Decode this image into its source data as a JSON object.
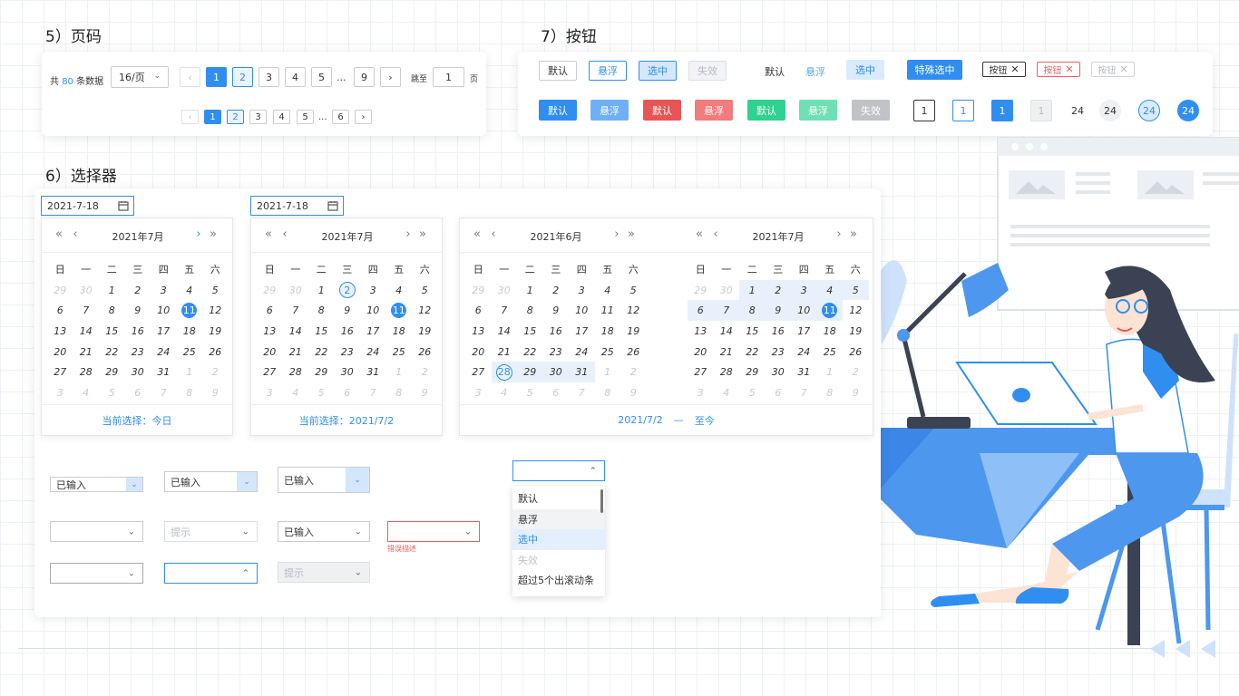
{
  "headings": {
    "pagination": "5）页码",
    "buttons": "7）按钮",
    "selector": "6）选择器"
  },
  "pagination": {
    "total_prefix": "共",
    "total_count": "80",
    "total_suffix": "条数据",
    "page_size": "16/页",
    "row1_pages": [
      "1",
      "2",
      "3",
      "4",
      "5",
      "...",
      "9"
    ],
    "row2_pages": [
      "1",
      "2",
      "3",
      "4",
      "5",
      "...",
      "6"
    ],
    "jump_label": "跳至",
    "jump_value": "1",
    "jump_suffix": "页",
    "prev": "‹",
    "next": "›"
  },
  "buttons": {
    "row1": {
      "default": "默认",
      "hover": "悬浮",
      "selected": "选中",
      "disabled": "失效",
      "text_default": "默认",
      "text_hover": "悬浮",
      "light_selected": "选中",
      "special_selected": "特殊选中",
      "tag_default": "按钮",
      "tag_danger": "按钮",
      "tag_disabled": "按钮"
    },
    "row2": {
      "blue_default": "默认",
      "blue_hover": "悬浮",
      "red_default": "默认",
      "red_hover": "悬浮",
      "green_default": "默认",
      "green_hover": "悬浮",
      "gray_disabled": "失效",
      "num_default": "1",
      "num_hover": "1",
      "num_active": "1",
      "num_disabled": "1",
      "circle_plain": "24",
      "circle_gray": "24",
      "circle_hover": "24",
      "circle_active": "24"
    }
  },
  "datepicker": {
    "input1_value": "2021-7-18",
    "input2_value": "2021-7-18",
    "weekdays": [
      "日",
      "一",
      "二",
      "三",
      "四",
      "五",
      "六"
    ],
    "cal1_title": "2021年7月",
    "cal2_title": "2021年7月",
    "cal3_title": "2021年6月",
    "cal4_title": "2021年7月",
    "cal1_footer": "当前选择：今日",
    "cal2_footer": "当前选择：2021/7/2",
    "range_footer_start": "2021/7/2",
    "range_footer_sep": "—",
    "range_footer_end": "至今",
    "july_days": [
      [
        "29",
        "30",
        "1",
        "2",
        "3",
        "4",
        "5"
      ],
      [
        "6",
        "7",
        "8",
        "9",
        "10",
        "11",
        "12"
      ],
      [
        "13",
        "14",
        "15",
        "16",
        "17",
        "18",
        "19"
      ],
      [
        "20",
        "21",
        "22",
        "23",
        "24",
        "25",
        "26"
      ],
      [
        "27",
        "28",
        "29",
        "30",
        "31",
        "1",
        "2"
      ],
      [
        "3",
        "4",
        "5",
        "6",
        "7",
        "8",
        "9"
      ]
    ],
    "june_days": [
      [
        "29",
        "30",
        "1",
        "2",
        "3",
        "4",
        "5"
      ],
      [
        "6",
        "7",
        "8",
        "9",
        "10",
        "11",
        "12"
      ],
      [
        "13",
        "14",
        "15",
        "16",
        "17",
        "18",
        "19"
      ],
      [
        "20",
        "21",
        "22",
        "23",
        "24",
        "25",
        "26"
      ],
      [
        "27",
        "28",
        "29",
        "30",
        "31",
        "1",
        "2"
      ],
      [
        "3",
        "4",
        "5",
        "6",
        "7",
        "8",
        "9"
      ]
    ]
  },
  "selects": {
    "s1": "已输入",
    "s2": "已输入",
    "s3": "已输入",
    "s6_placeholder": "提示",
    "s7": "已输入",
    "error_desc": "错误描述",
    "s11_placeholder": "提示",
    "dropdown_options": [
      "默认",
      "悬浮",
      "选中",
      "失效",
      "超过5个出滚动条"
    ]
  },
  "colors": {
    "primary": "#2f8ef0",
    "danger": "#f25c5c",
    "success": "#3fd69c",
    "disabled": "#c0c4cc"
  }
}
